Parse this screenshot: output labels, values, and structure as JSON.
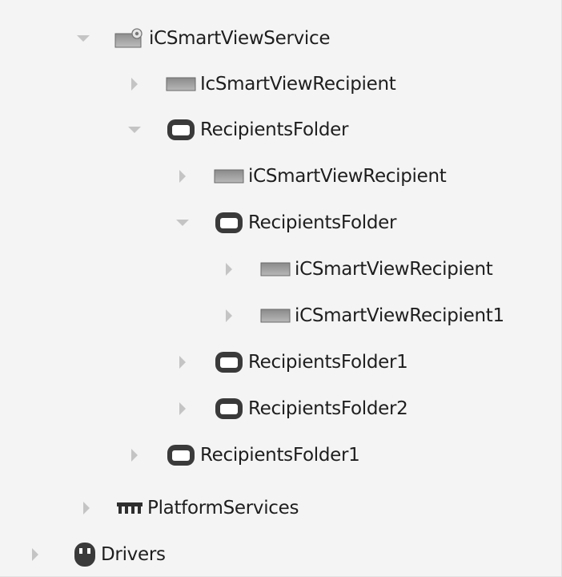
{
  "tree": {
    "nodes": [
      {
        "id": "n0",
        "label": "iCSmartViewService",
        "icon": "service-icon",
        "toggle": "expanded"
      },
      {
        "id": "n1",
        "label": "IcSmartViewRecipient",
        "icon": "recipient-icon",
        "toggle": "collapsed"
      },
      {
        "id": "n2",
        "label": "RecipientsFolder",
        "icon": "folder-icon",
        "toggle": "expanded"
      },
      {
        "id": "n3",
        "label": "iCSmartViewRecipient",
        "icon": "recipient-icon",
        "toggle": "collapsed"
      },
      {
        "id": "n4",
        "label": "RecipientsFolder",
        "icon": "folder-icon",
        "toggle": "expanded"
      },
      {
        "id": "n5",
        "label": "iCSmartViewRecipient",
        "icon": "recipient-icon",
        "toggle": "collapsed"
      },
      {
        "id": "n6",
        "label": "iCSmartViewRecipient1",
        "icon": "recipient-icon",
        "toggle": "collapsed"
      },
      {
        "id": "n7",
        "label": "RecipientsFolder1",
        "icon": "folder-icon",
        "toggle": "collapsed"
      },
      {
        "id": "n8",
        "label": "RecipientsFolder2",
        "icon": "folder-icon",
        "toggle": "collapsed"
      },
      {
        "id": "n9",
        "label": "RecipientsFolder1",
        "icon": "folder-icon",
        "toggle": "collapsed"
      },
      {
        "id": "n10",
        "label": "PlatformServices",
        "icon": "platform-services-icon",
        "toggle": "collapsed"
      },
      {
        "id": "n11",
        "label": "Drivers",
        "icon": "drivers-icon",
        "toggle": "collapsed"
      }
    ]
  },
  "colors": {
    "panel": "#f4f4f4",
    "toggle": "#c4c4c4",
    "icon_dark": "#3a3a3a",
    "recipient_fill": "#9c9c9c",
    "text": "#1e1e1e"
  }
}
